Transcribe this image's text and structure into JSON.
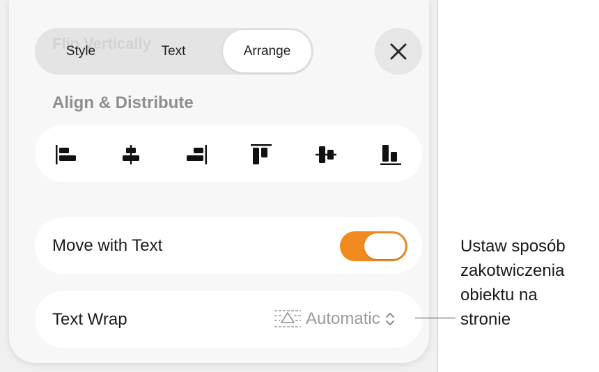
{
  "panel": {
    "ghost_title": "Flip Vertically",
    "tabs": [
      {
        "label": "Style",
        "selected": false
      },
      {
        "label": "Text",
        "selected": false
      },
      {
        "label": "Arrange",
        "selected": true
      }
    ],
    "close_icon": "close-icon"
  },
  "align_section": {
    "title": "Align & Distribute",
    "buttons": [
      {
        "icon": "align-left-icon"
      },
      {
        "icon": "align-center-icon"
      },
      {
        "icon": "align-right-icon"
      },
      {
        "icon": "align-top-icon"
      },
      {
        "icon": "align-middle-icon"
      },
      {
        "icon": "align-bottom-icon"
      }
    ]
  },
  "move_with_text": {
    "label": "Move with Text",
    "enabled": true,
    "toggle_color": "#f28b1f"
  },
  "text_wrap": {
    "label": "Text Wrap",
    "value": "Automatic",
    "icon": "text-wrap-icon",
    "chevron_icon": "up-down-chevron-icon"
  },
  "callout": {
    "text": "Ustaw sposób\nzakotwiczenia\nobiektu na\nstronie"
  }
}
